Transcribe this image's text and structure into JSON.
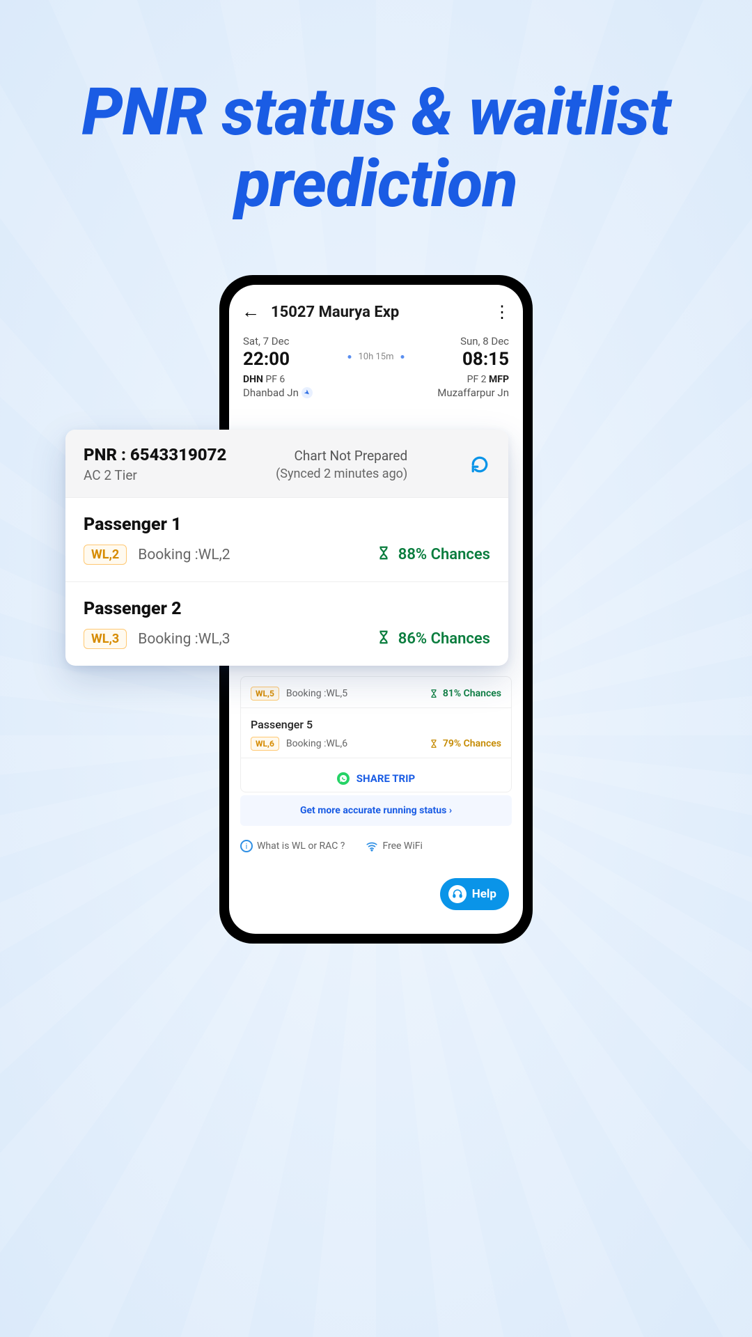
{
  "headline": "PNR status & waitlist prediction",
  "app": {
    "train_title": "15027 Maurya Exp",
    "depart": {
      "date": "Sat, 7 Dec",
      "time": "22:00",
      "code": "DHN",
      "pf": "PF 6",
      "station": "Dhanbad Jn"
    },
    "duration": "10h 15m",
    "arrive": {
      "date": "Sun, 8 Dec",
      "time": "08:15",
      "code": "MFP",
      "pf": "PF 2",
      "station": "Muzaffarpur Jn"
    }
  },
  "overlay": {
    "pnr": "PNR : 6543319072",
    "class": "AC 2 Tier",
    "chart_status": "Chart Not Prepared",
    "synced": "(Synced 2 minutes ago)",
    "passengers": [
      {
        "name": "Passenger 1",
        "wl": "WL,2",
        "booking": "Booking :WL,2",
        "chance": "88% Chances"
      },
      {
        "name": "Passenger 2",
        "wl": "WL,3",
        "booking": "Booking :WL,3",
        "chance": "86% Chances"
      }
    ]
  },
  "behind": {
    "rows": [
      {
        "name": "",
        "wl": "WL,5",
        "booking": "Booking :WL,5",
        "chance": "81% Chances",
        "tone": "green"
      },
      {
        "name": "Passenger 5",
        "wl": "WL,6",
        "booking": "Booking :WL,6",
        "chance": "79% Chances",
        "tone": "amber"
      }
    ]
  },
  "share_trip": "SHARE TRIP",
  "accurate": "Get more accurate running status",
  "footer": {
    "wl_rac": "What is WL or RAC ?",
    "wifi": "Free WiFi"
  },
  "help_label": "Help"
}
